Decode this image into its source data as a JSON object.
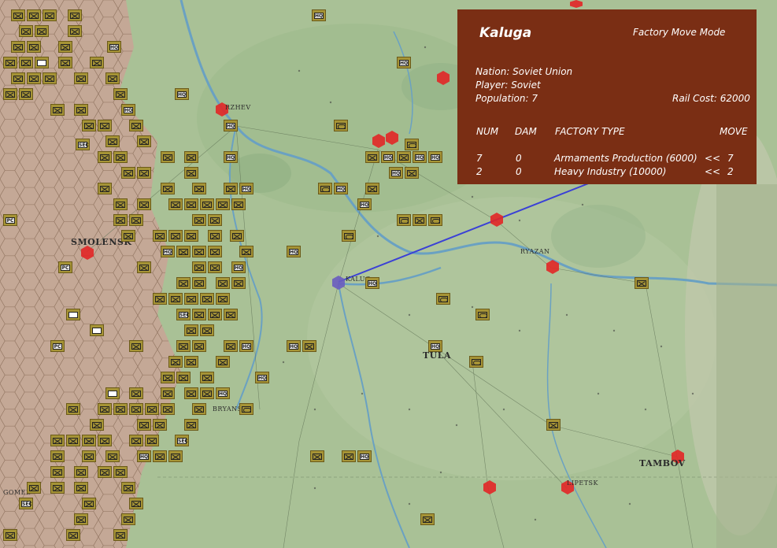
{
  "panel": {
    "city": "Kaluga",
    "mode": "Factory Move Mode",
    "nation": "Nation: Soviet Union",
    "player": "Player: Soviet",
    "population": "Population: 7",
    "rail_cost": "Rail Cost: 62000",
    "headers": {
      "num": "NUM",
      "dam": "DAM",
      "type": "FACTORY TYPE",
      "move": "MOVE"
    },
    "rows": [
      {
        "num": "7",
        "dam": "0",
        "type": "Armaments Production (6000)",
        "arrow": "<<",
        "move": "7"
      },
      {
        "num": "2",
        "dam": "0",
        "type": "Heavy Industry (10000)",
        "arrow": "<<",
        "move": "2"
      }
    ]
  },
  "map": {
    "cities": {
      "smolensk": "SMOLENSK",
      "tula": "TULA",
      "tambov": "TAMBOV",
      "ryazan": "RYAZAN",
      "kaluga": "KALUG",
      "bryansk": "BRYANSK",
      "gomel": "GOMEL",
      "lipetsk": "LIPETSK",
      "rzhev": "RZHEV"
    },
    "unit_labels": {
      "hq": "HQ",
      "sec": "SEC",
      "pc": "PC"
    },
    "colors": {
      "panel": "#7a2e14",
      "land": "#a8bf94",
      "occupied": "#c3a48f",
      "river": "#6aa1c2",
      "rail_line": "#3a40d6",
      "victory_point": "#e22626"
    }
  }
}
